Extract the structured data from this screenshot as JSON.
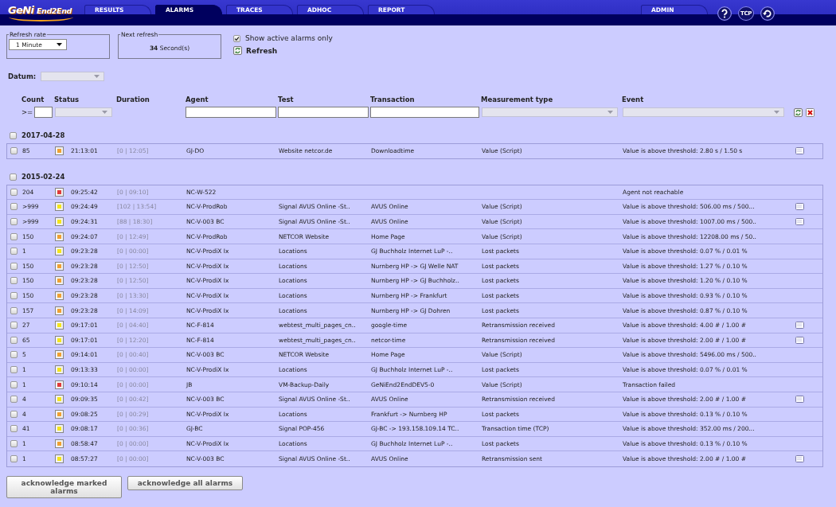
{
  "header": {
    "logo": [
      "GeNi",
      "End2End"
    ],
    "tabs": [
      {
        "label": "RESULTS",
        "selected": false
      },
      {
        "label": "ALARMS",
        "selected": true
      },
      {
        "label": "TRACES",
        "selected": false
      },
      {
        "label": "ADHOC",
        "selected": false
      },
      {
        "label": "REPORT",
        "selected": false
      }
    ],
    "admin_tab": {
      "label": "ADMIN",
      "selected": false
    },
    "tcp_button": {
      "label": "TCP"
    }
  },
  "refresh_rate": {
    "legend": "Refresh rate",
    "value": "1 Minute"
  },
  "next_refresh": {
    "legend": "Next refresh",
    "value": "**34** Second(s)"
  },
  "active_only": {
    "label": "Show active alarms only",
    "checked": true
  },
  "refresh_button": {
    "label": "Refresh"
  },
  "datum": {
    "label": "Datum:",
    "disabled": true
  },
  "columns": [
    "Count",
    "Status",
    "Duration",
    "Agent",
    "Test",
    "Transaction",
    "Measurement type",
    "Event"
  ],
  "filters": [
    {
      "kind": "count",
      "operator": ">="
    },
    {
      "kind": "select",
      "disabled": true
    },
    {
      "kind": "text"
    },
    {
      "kind": "text"
    },
    {
      "kind": "text"
    },
    {
      "kind": "select",
      "disabled": true
    },
    {
      "kind": "select",
      "disabled": true
    }
  ],
  "groups": [
    {
      "date": "2017-04-28",
      "checked": false,
      "rows": [
        {
          "checked": false,
          "count": "85",
          "color": "#f0a030",
          "time": "21:13:01",
          "duration": "[0 | 12:05]",
          "agent": "GJ-DO",
          "test": "Website netcor.de",
          "transaction": "Downloadtime",
          "measurement": "Value (Script)",
          "event": "Value is above threshold: 2.80 s / 1.50 s",
          "note": true
        }
      ]
    },
    {
      "date": "2015-02-24",
      "checked": false,
      "rows": [
        {
          "checked": false,
          "count": "204",
          "color": "#e03a3a",
          "time": "09:25:42",
          "duration": "[0 | 09:10]",
          "agent": "NC-W-522",
          "event": "Agent not reachable",
          "note": false
        },
        {
          "checked": false,
          "count": ">999",
          "color": "#f5e61a",
          "time": "09:24:49",
          "duration": "[102 | 13:54]",
          "agent": "NC-V-ProdRob",
          "test": "Signal AVUS Online -St..",
          "transaction": "AVUS Online",
          "measurement": "Value (Script)",
          "event": "Value is above threshold: 506.00 ms / 500...",
          "note": true
        },
        {
          "checked": false,
          "count": ">999",
          "color": "#f5e61a",
          "time": "09:24:31",
          "duration": "[88 | 18:30]",
          "agent": "NC-V-003 BC",
          "test": "Signal AVUS Online -St..",
          "transaction": "AVUS Online",
          "measurement": "Value (Script)",
          "event": "Value is above threshold: 1007.00 ms / 500..",
          "note": true
        },
        {
          "checked": false,
          "count": "150",
          "color": "#f0a030",
          "time": "09:24:07",
          "duration": "[0 | 12:49]",
          "agent": "NC-V-ProdRob",
          "test": "NETCOR Website",
          "transaction": "Home Page",
          "measurement": "Value (Script)",
          "event": "Value is above threshold: 12208.00 ms / 50..",
          "note": false
        },
        {
          "checked": false,
          "count": "1",
          "color": "#f5e61a",
          "time": "09:23:28",
          "duration": "[0 | 00:00]",
          "agent": "NC-V-ProdiX Ix",
          "test": "Locations",
          "transaction": "GJ Buchholz Internet LuP -..",
          "measurement": "Lost packets",
          "event": "Value is above threshold: 0.07 % / 0.01 %",
          "note": false
        },
        {
          "checked": false,
          "count": "150",
          "color": "#f0a030",
          "time": "09:23:28",
          "duration": "[0 | 12:50]",
          "agent": "NC-V-ProdiX Ix",
          "test": "Locations",
          "transaction": "Nurnberg HP -> GJ Welle NAT",
          "measurement": "Lost packets",
          "event": "Value is above threshold: 1.27 % / 0.10 %",
          "note": false
        },
        {
          "checked": false,
          "count": "150",
          "color": "#f0a030",
          "time": "09:23:28",
          "duration": "[0 | 12:50]",
          "agent": "NC-V-ProdiX Ix",
          "test": "Locations",
          "transaction": "Nurnberg HP -> GJ Buchholz..",
          "measurement": "Lost packets",
          "event": "Value is above threshold: 1.20 % / 0.10 %",
          "note": false
        },
        {
          "checked": false,
          "count": "150",
          "color": "#f0a030",
          "time": "09:23:28",
          "duration": "[0 | 13:30]",
          "agent": "NC-V-ProdiX Ix",
          "test": "Locations",
          "transaction": "Nurnberg HP -> Frankfurt",
          "measurement": "Lost packets",
          "event": "Value is above threshold: 0.93 % / 0.10 %",
          "note": false
        },
        {
          "checked": false,
          "count": "157",
          "color": "#f0a030",
          "time": "09:23:28",
          "duration": "[0 | 14:09]",
          "agent": "NC-V-ProdiX Ix",
          "test": "Locations",
          "transaction": "Nurnberg HP -> GJ Dohren",
          "measurement": "Lost packets",
          "event": "Value is above threshold: 0.87 % / 0.10 %",
          "note": false
        },
        {
          "checked": false,
          "count": "27",
          "color": "#f5e61a",
          "time": "09:17:01",
          "duration": "[0 | 04:40]",
          "agent": "NC-F-814",
          "test": "webtest_multi_pages_cn..",
          "transaction": "google-time",
          "measurement": "Retransmission received",
          "event": "Value is above threshold: 4.00 # / 1.00 #",
          "note": true
        },
        {
          "checked": false,
          "count": "65",
          "color": "#f5e61a",
          "time": "09:17:01",
          "duration": "[0 | 12:20]",
          "agent": "NC-F-814",
          "test": "webtest_multi_pages_cn..",
          "transaction": "netcor-time",
          "measurement": "Retransmission received",
          "event": "Value is above threshold: 2.00 # / 1.00 #",
          "note": true
        },
        {
          "checked": false,
          "count": "5",
          "color": "#f0a030",
          "time": "09:14:01",
          "duration": "[0 | 00:40]",
          "agent": "NC-V-003 BC",
          "test": "NETCOR Website",
          "transaction": "Home Page",
          "measurement": "Value (Script)",
          "event": "Value is above threshold: 5496.00 ms / 500..",
          "note": false
        },
        {
          "checked": false,
          "count": "1",
          "color": "#f5e61a",
          "time": "09:13:33",
          "duration": "[0 | 00:00]",
          "agent": "NC-V-ProdiX Ix",
          "test": "Locations",
          "transaction": "GJ Buchholz Internet LuP -..",
          "measurement": "Lost packets",
          "event": "Value is above threshold: 0.07 % / 0.01 %",
          "note": false
        },
        {
          "checked": false,
          "count": "1",
          "color": "#e03a3a",
          "time": "09:10:14",
          "duration": "[0 | 00:00]",
          "agent": "JB",
          "test": "VM-Backup-Daily",
          "transaction": "GeNiEnd2EndDEV5-0",
          "measurement": "Value (Script)",
          "event": "Transaction failed",
          "note": false
        },
        {
          "checked": false,
          "count": "4",
          "color": "#f5e61a",
          "time": "09:09:35",
          "duration": "[0 | 00:42]",
          "agent": "NC-V-003 BC",
          "test": "Signal AVUS Online -St..",
          "transaction": "AVUS Online",
          "measurement": "Retransmission received",
          "event": "Value is above threshold: 2.00 # / 1.00 #",
          "note": true
        },
        {
          "checked": false,
          "count": "4",
          "color": "#f0a030",
          "time": "09:08:25",
          "duration": "[0 | 00:29]",
          "agent": "NC-V-ProdiX Ix",
          "test": "Locations",
          "transaction": "Frankfurt -> Nurnberg HP",
          "measurement": "Lost packets",
          "event": "Value is above threshold: 0.13 % / 0.10 %",
          "note": false
        },
        {
          "checked": false,
          "count": "41",
          "color": "#f5e61a",
          "time": "09:08:17",
          "duration": "[0 | 00:36]",
          "agent": "GJ-BC",
          "test": "Signal POP-456",
          "transaction": "GJ-BC -> 193.158.109.14 TC..",
          "measurement": "Transaction time (TCP)",
          "event": "Value is above threshold: 352.00 ms / 200...",
          "note": false
        },
        {
          "checked": false,
          "count": "1",
          "color": "#f0a030",
          "time": "08:58:47",
          "duration": "[0 | 00:00]",
          "agent": "NC-V-ProdiX Ix",
          "test": "Locations",
          "transaction": "GJ Buchholz Internet LuP -..",
          "measurement": "Lost packets",
          "event": "Value is above threshold: 0.13 % / 0.10 %",
          "note": false
        },
        {
          "checked": false,
          "count": "1",
          "color": "#f5e61a",
          "time": "08:57:27",
          "duration": "[0 | 00:00]",
          "agent": "NC-V-003 BC",
          "test": "Signal AVUS Online -St..",
          "transaction": "AVUS Online",
          "measurement": "Retransmission sent",
          "event": "Value is above threshold: 2.00 # / 1.00 #",
          "note": true
        }
      ]
    }
  ],
  "buttons": [
    {
      "label": "acknowledge marked alarms"
    },
    {
      "label": "acknowledge all alarms"
    }
  ]
}
